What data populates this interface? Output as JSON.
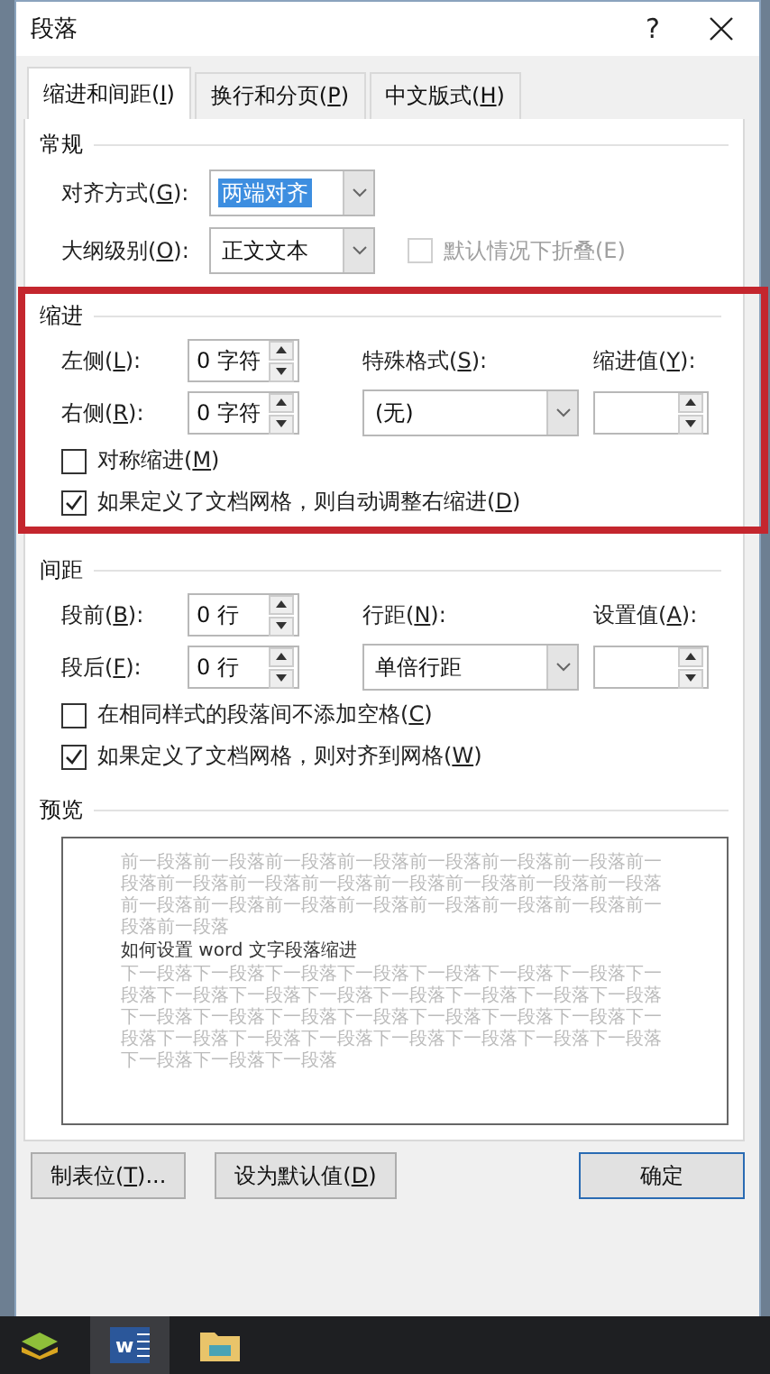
{
  "window": {
    "title": "段落",
    "help": "?"
  },
  "tabs": [
    {
      "label": [
        "缩进和间距(",
        "I",
        ")"
      ],
      "selected": true
    },
    {
      "label": [
        "换行和分页(",
        "P",
        ")"
      ],
      "selected": false
    },
    {
      "label": [
        "中文版式(",
        "H",
        ")"
      ],
      "selected": false
    }
  ],
  "general": {
    "title": "常规",
    "alignment": {
      "label": [
        "对齐方式(",
        "G",
        "):"
      ],
      "value": "两端对齐",
      "focused": true
    },
    "outline_level": {
      "label": [
        "大纲级别(",
        "O",
        "):"
      ],
      "value": "正文文本",
      "focused": false
    },
    "collapse": {
      "label": "默认情况下折叠(E)",
      "checked": false,
      "disabled": true
    }
  },
  "indent": {
    "title": "缩进",
    "highlighted": true,
    "left": {
      "label": [
        "左侧(",
        "L",
        "):"
      ],
      "value": "0 字符"
    },
    "right": {
      "label": [
        "右侧(",
        "R",
        "):"
      ],
      "value": "0 字符"
    },
    "special": {
      "label": [
        "特殊格式(",
        "S",
        "):"
      ],
      "value": "(无)"
    },
    "by": {
      "label": [
        "缩进值(",
        "Y",
        "):"
      ]
    },
    "checkboxes": [
      {
        "label": [
          "对称缩进(",
          "M",
          ")"
        ],
        "checked": false
      },
      {
        "label": [
          "如果定义了文档网格，则自动调整右缩进(",
          "D",
          ")"
        ],
        "checked": true
      }
    ]
  },
  "spacing": {
    "title": "间距",
    "highlighted": false,
    "left": {
      "label": [
        "段前(",
        "B",
        "):"
      ],
      "value": "0 行"
    },
    "right": {
      "label": [
        "段后(",
        "F",
        "):"
      ],
      "value": "0 行"
    },
    "special": {
      "label": [
        "行距(",
        "N",
        "):"
      ],
      "value": "单倍行距"
    },
    "by": {
      "label": [
        "设置值(",
        "A",
        "):"
      ]
    },
    "checkboxes": [
      {
        "label": [
          "在相同样式的段落间不添加空格(",
          "C",
          ")"
        ],
        "checked": false
      },
      {
        "label": [
          "如果定义了文档网格，则对齐到网格(",
          "W",
          ")"
        ],
        "checked": true
      }
    ]
  },
  "preview": {
    "title": "预览",
    "previous": "前一段落前一段落前一段落前一段落前一段落前一段落前一段落前一段落前一段落前一段落前一段落前一段落前一段落前一段落前一段落前一段落前一段落前一段落前一段落前一段落前一段落前一段落前一段落前一段落",
    "sample": "如何设置 word 文字段落缩进",
    "next": "下一段落下一段落下一段落下一段落下一段落下一段落下一段落下一段落下一段落下一段落下一段落下一段落下一段落下一段落下一段落下一段落下一段落下一段落下一段落下一段落下一段落下一段落下一段落下一段落下一段落下一段落下一段落下一段落下一段落下一段落下一段落下一段落下一段落"
  },
  "buttons": [
    {
      "label": [
        "制表位(",
        "T",
        ")..."
      ],
      "default": false
    },
    {
      "label": [
        "设为默认值(",
        "D",
        ")"
      ],
      "default": false
    },
    {
      "label": [
        "确定"
      ],
      "default": true
    }
  ],
  "taskbar": {
    "apps": [
      {
        "kind": "stack",
        "active": false
      },
      {
        "kind": "word",
        "letter": "w",
        "active": true
      },
      {
        "kind": "folder",
        "active": false
      }
    ]
  }
}
